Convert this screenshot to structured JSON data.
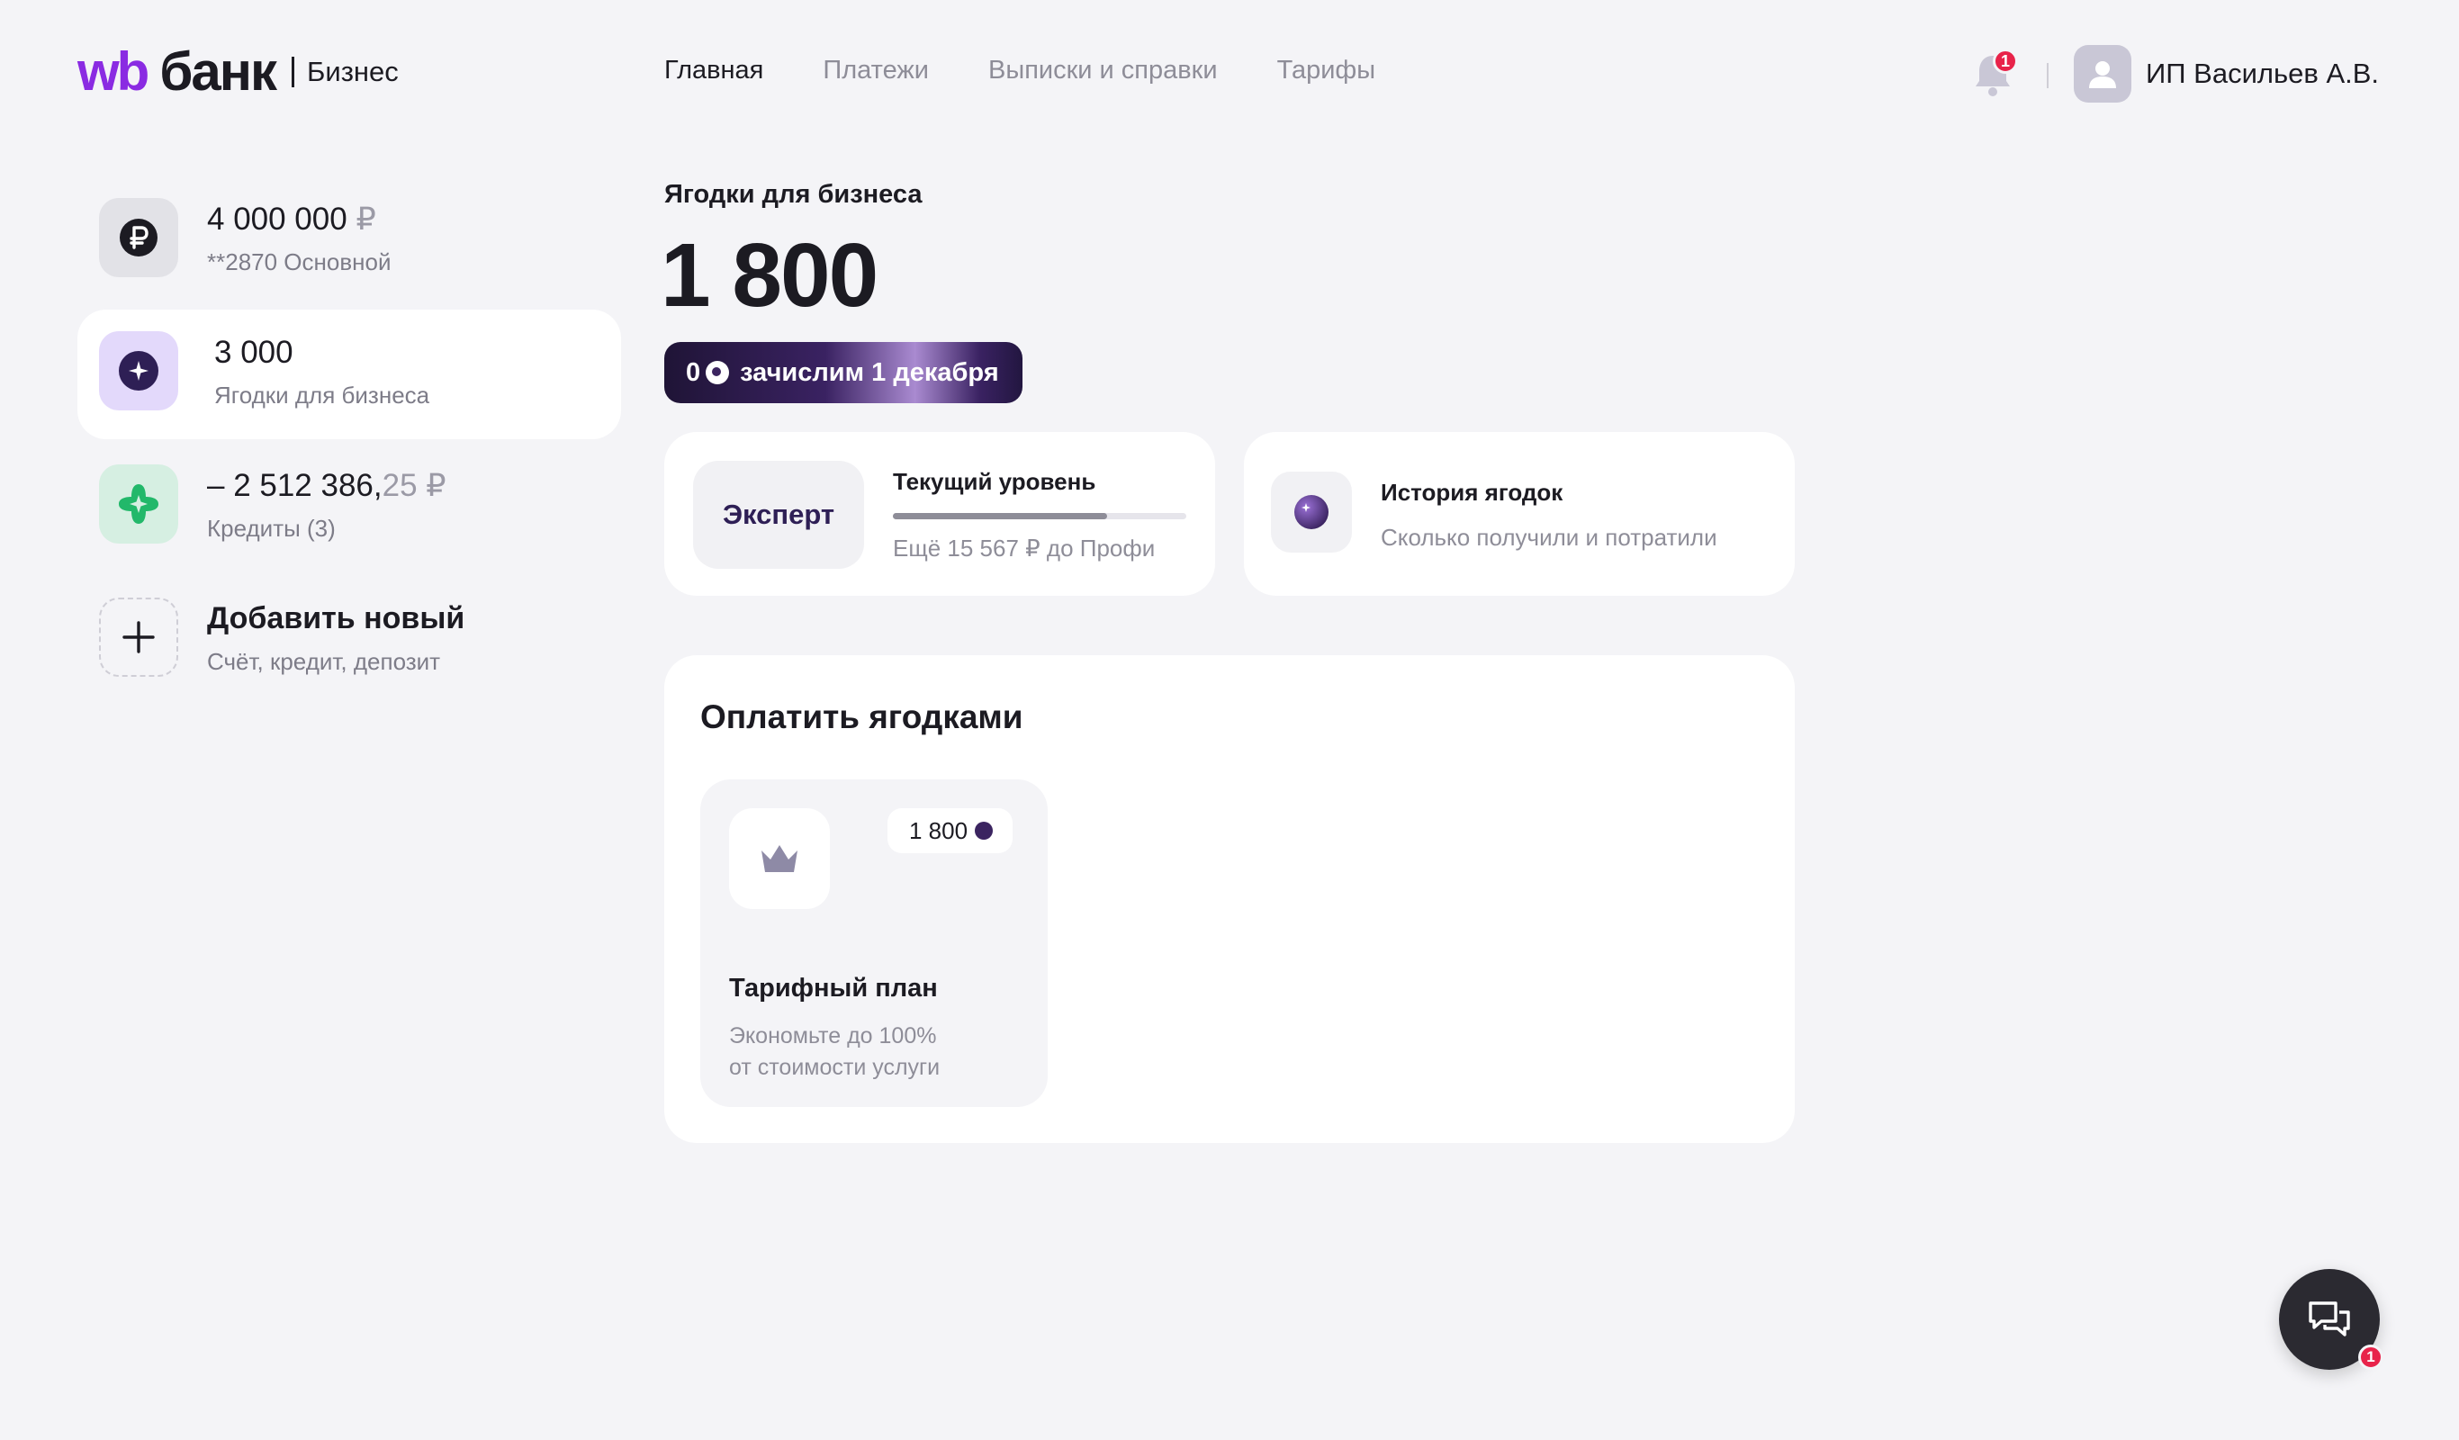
{
  "header": {
    "logo_wb": "wb",
    "logo_bank": "банк",
    "logo_business": "Бизнес",
    "nav": [
      {
        "label": "Главная",
        "active": true
      },
      {
        "label": "Платежи",
        "active": false
      },
      {
        "label": "Выписки и справки",
        "active": false
      },
      {
        "label": "Тарифы",
        "active": false
      }
    ],
    "notifications_count": "1",
    "user_name": "ИП Васильев А.В."
  },
  "sidebar": {
    "accounts": [
      {
        "amount": "4 000 000",
        "currency": "₽",
        "subtitle": "**2870 Основной",
        "icon": "ruble-icon",
        "selected": false
      },
      {
        "amount": "3 000",
        "subtitle": "Ягодки для бизнеса",
        "icon": "berry-icon",
        "selected": true
      },
      {
        "amount": "– 2 512 386,",
        "cents": "25",
        "currency": "₽",
        "subtitle": "Кредиты (3)",
        "icon": "credit-icon",
        "selected": false
      }
    ],
    "add_new": {
      "title": "Добавить новый",
      "subtitle": "Счёт, кредит, депозит",
      "icon": "plus-icon"
    }
  },
  "main": {
    "section_label": "Ягодки для бизнеса",
    "balance": "1 800",
    "accrual": {
      "amount": "0",
      "text": "зачислим 1 декабря"
    },
    "level": {
      "badge": "Эксперт",
      "title": "Текущий уровень",
      "progress": 0.73,
      "subtitle": "Ещё 15 567 ₽ до Профи"
    },
    "history": {
      "title": "История ягодок",
      "subtitle": "Сколько получили и потратили",
      "icon": "berry-icon"
    },
    "pay": {
      "title": "Оплатить ягодками",
      "tiles": [
        {
          "price": "1 800",
          "title": "Тарифный план",
          "subtitle_line1": "Экономьте до 100%",
          "subtitle_line2": "от стоимости услуги",
          "icon": "crown-icon"
        }
      ]
    }
  },
  "chat": {
    "badge": "1",
    "icon": "chat-icon"
  },
  "colors": {
    "background": "#f4f4f7",
    "brand_purple": "#8a2be2",
    "badge_red": "#e8234a",
    "berry_dark": "#3b2460",
    "credit_green": "#22b86a"
  }
}
